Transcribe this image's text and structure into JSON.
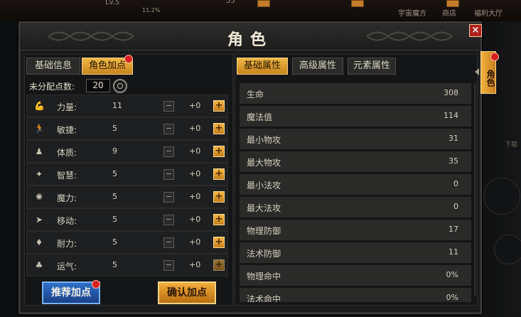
{
  "hud": {
    "level": "Lv.5",
    "hp_text": "11.2%",
    "count": "55",
    "links": [
      "宇宙魔方",
      "商店",
      "福利大厅"
    ]
  },
  "window": {
    "title": "角色",
    "close": "×"
  },
  "left": {
    "tabs": [
      {
        "label": "基础信息",
        "active": false
      },
      {
        "label": "角色加点",
        "active": true
      }
    ],
    "points_label": "未分配点数:",
    "points_value": "20",
    "attributes": [
      {
        "icon": "strength-icon",
        "glyph": "💪",
        "label": "力量:",
        "value": "11",
        "minus": "−",
        "plus_value": "+0",
        "plus": "+"
      },
      {
        "icon": "agility-icon",
        "glyph": "🏃",
        "label": "敏捷:",
        "value": "5",
        "minus": "−",
        "plus_value": "+0",
        "plus": "+"
      },
      {
        "icon": "constitution-icon",
        "glyph": "♟",
        "label": "体质:",
        "value": "9",
        "minus": "−",
        "plus_value": "+0",
        "plus": "+"
      },
      {
        "icon": "wisdom-icon",
        "glyph": "✦",
        "label": "智慧:",
        "value": "5",
        "minus": "−",
        "plus_value": "+0",
        "plus": "+"
      },
      {
        "icon": "magic-icon",
        "glyph": "✺",
        "label": "魔力:",
        "value": "5",
        "minus": "−",
        "plus_value": "+0",
        "plus": "+"
      },
      {
        "icon": "movement-icon",
        "glyph": "➤",
        "label": "移动:",
        "value": "5",
        "minus": "−",
        "plus_value": "+0",
        "plus": "+"
      },
      {
        "icon": "endurance-icon",
        "glyph": "♦",
        "label": "耐力:",
        "value": "5",
        "minus": "−",
        "plus_value": "+0",
        "plus": "+"
      },
      {
        "icon": "luck-icon",
        "glyph": "♣",
        "label": "运气:",
        "value": "5",
        "minus": "−",
        "plus_value": "+0",
        "plus": "+"
      }
    ],
    "recommend_button": "推荐加点",
    "confirm_button": "确认加点"
  },
  "right": {
    "tabs": [
      {
        "label": "基础属性",
        "active": true
      },
      {
        "label": "高级属性",
        "active": false
      },
      {
        "label": "元素属性",
        "active": false
      }
    ],
    "stats": [
      {
        "name": "生命",
        "value": "308"
      },
      {
        "name": "魔法值",
        "value": "114"
      },
      {
        "name": "最小物攻",
        "value": "31"
      },
      {
        "name": "最大物攻",
        "value": "35"
      },
      {
        "name": "最小法攻",
        "value": "0"
      },
      {
        "name": "最大法攻",
        "value": "0"
      },
      {
        "name": "物理防御",
        "value": "17"
      },
      {
        "name": "法术防御",
        "value": "11"
      },
      {
        "name": "物理命中",
        "value": "0%"
      },
      {
        "name": "法术命中",
        "value": "0%"
      }
    ]
  },
  "side_tab": "角色",
  "side_note": "下载",
  "colors": {
    "accent_gold": "#f0b845",
    "button_blue": "#2f70c7",
    "close_red": "#b0201a",
    "notify_red": "#d8201e"
  }
}
